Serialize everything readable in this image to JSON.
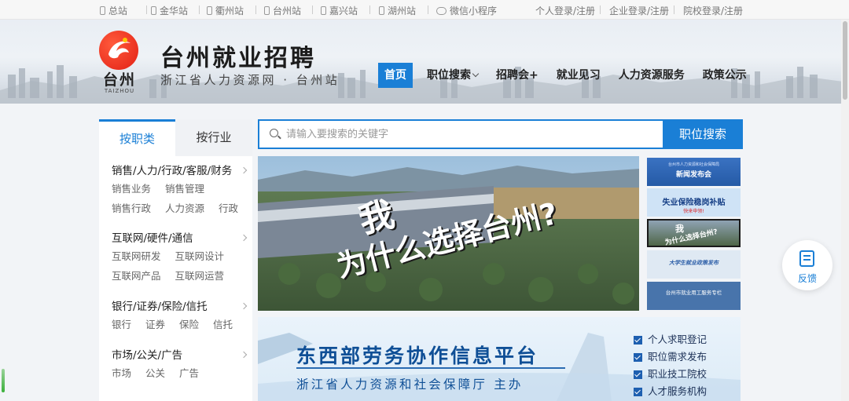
{
  "topbar": {
    "sites": [
      "总站",
      "金华站",
      "衢州站",
      "台州站",
      "嘉兴站",
      "湖州站"
    ],
    "miniprogram": "微信小程序",
    "logins": [
      "个人登录/注册",
      "企业登录/注册",
      "院校登录/注册"
    ]
  },
  "header": {
    "logo_cn": "台州",
    "logo_en": "TAIZHOU",
    "title": "台州就业招聘",
    "subtitle": "浙江省人力资源网 · 台州站",
    "nav": [
      "首页",
      "职位搜索",
      "招聘会+",
      "就业见习",
      "人力资源服务",
      "政策公示"
    ]
  },
  "categories": {
    "tabs": [
      "按职类",
      "按行业"
    ],
    "groups": [
      {
        "title": "销售/人力/行政/客服/财务",
        "rows": [
          [
            "销售业务",
            "销售管理"
          ],
          [
            "销售行政",
            "人力资源",
            "行政"
          ]
        ]
      },
      {
        "title": "互联网/硬件/通信",
        "rows": [
          [
            "互联网研发",
            "互联网设计"
          ],
          [
            "互联网产品",
            "互联网运营"
          ]
        ]
      },
      {
        "title": "银行/证券/保险/信托",
        "rows": [
          [
            "银行",
            "证券",
            "保险",
            "信托"
          ]
        ]
      },
      {
        "title": "市场/公关/广告",
        "rows": [
          [
            "市场",
            "公关",
            "广告"
          ]
        ]
      }
    ]
  },
  "search": {
    "placeholder": "请输入要搜索的关键字",
    "button": "职位搜索"
  },
  "banner": {
    "line1": "我",
    "line2": "为什么选择台州?"
  },
  "thumbs": {
    "t1_top": "台州市人力资源和社会保障局",
    "t1": "新闻发布会",
    "t2": "失业保险稳岗补贴",
    "t2_sub": "快来申领!",
    "t3a": "我",
    "t3b": "为什么选择台州?",
    "t4": "大学生就业政策发布",
    "t5": "台州市就业用工服务专栏"
  },
  "platform": {
    "title": "东西部劳务协作信息平台",
    "subtitle": "浙江省人力资源和社会保障厅  主办",
    "items": [
      "个人求职登记",
      "职位需求发布",
      "职业技工院校",
      "人才服务机构"
    ]
  },
  "feedback": {
    "label": "反馈"
  },
  "colors": {
    "accent": "#1a7fd6",
    "logo_red": "#e22014",
    "platform_blue": "#0f4f96"
  }
}
